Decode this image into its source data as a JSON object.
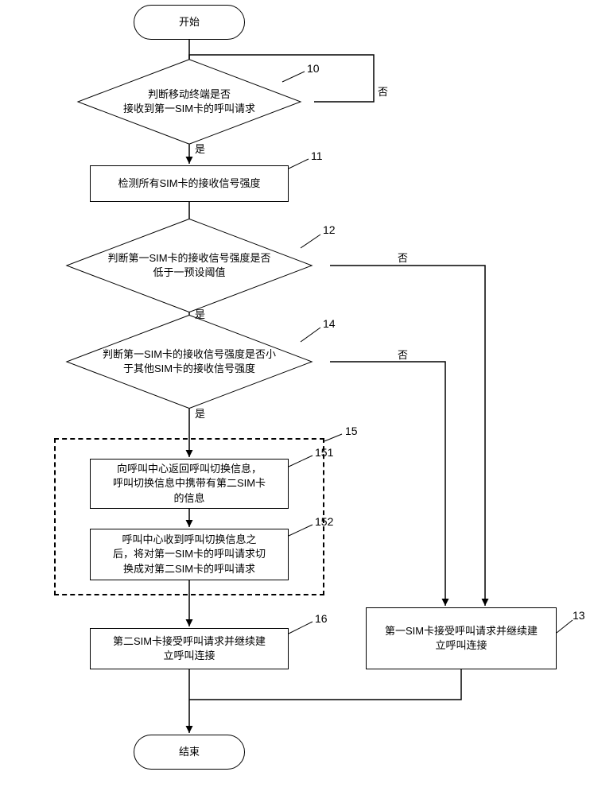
{
  "terminals": {
    "start": "开始",
    "end": "结束"
  },
  "decisions": {
    "d10": "判断移动终端是否\n接收到第一SIM卡的呼叫请求",
    "d12": "判断第一SIM卡的接收信号强度是否\n低于一预设阈值",
    "d14": "判断第一SIM卡的接收信号强度是否小\n于其他SIM卡的接收信号强度"
  },
  "processes": {
    "p11": "检测所有SIM卡的接收信号强度",
    "p151": "向呼叫中心返回呼叫切换信息，\n呼叫切换信息中携带有第二SIM卡\n的信息",
    "p152": "呼叫中心收到呼叫切换信息之\n后，将对第一SIM卡的呼叫请求切\n换成对第二SIM卡的呼叫请求",
    "p16": "第二SIM卡接受呼叫请求并继续建\n立呼叫连接",
    "p13": "第一SIM卡接受呼叫请求并继续建\n立呼叫连接"
  },
  "branch_labels": {
    "yes": "是",
    "no": "否"
  },
  "step_numbers": {
    "s10": "10",
    "s11": "11",
    "s12": "12",
    "s13": "13",
    "s14": "14",
    "s15": "15",
    "s151": "151",
    "s152": "152",
    "s16": "16"
  }
}
